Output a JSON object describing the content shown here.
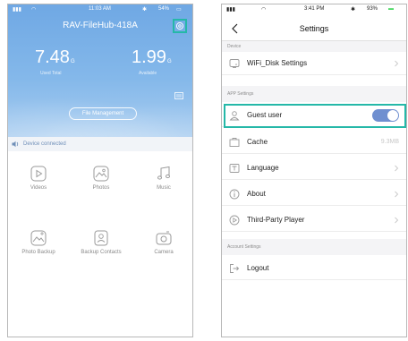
{
  "left_screen": {
    "status": {
      "time": "11:03 AM",
      "battery": "54%"
    },
    "title": "RAV-FileHub-418A",
    "stats": [
      {
        "value": "7.48",
        "unit": "G",
        "caption": "Used Total"
      },
      {
        "value": "1.99",
        "unit": "G",
        "caption": "Available"
      }
    ],
    "file_management": "File Management",
    "connection_status": "Device connected",
    "grid": [
      {
        "label": "Videos",
        "icon": "play-icon"
      },
      {
        "label": "Photos",
        "icon": "photo-icon"
      },
      {
        "label": "Music",
        "icon": "music-icon"
      },
      {
        "label": "Photo Backup",
        "icon": "photo-backup-icon"
      },
      {
        "label": "Backup Contacts",
        "icon": "contact-icon"
      },
      {
        "label": "Camera",
        "icon": "camera-icon"
      }
    ],
    "colors": {
      "hero_top": "#6fa8e4",
      "highlight": "#25b8a8",
      "connection_text": "#6f8fb8"
    }
  },
  "right_screen": {
    "status": {
      "time": "3:41 PM",
      "battery": "93%"
    },
    "title": "Settings",
    "sections": {
      "device": "Device",
      "app": "APP Settings",
      "account": "Account Settings"
    },
    "rows": {
      "wifi_disk": "WiFi_Disk Settings",
      "guest_user": "Guest user",
      "cache": "Cache",
      "cache_value": "9.3MB",
      "language": "Language",
      "about": "About",
      "third_party": "Third-Party Player",
      "logout": "Logout"
    },
    "guest_user_enabled": true,
    "colors": {
      "toggle_on": "#6f8fd0",
      "highlight": "#25b8a8"
    }
  }
}
